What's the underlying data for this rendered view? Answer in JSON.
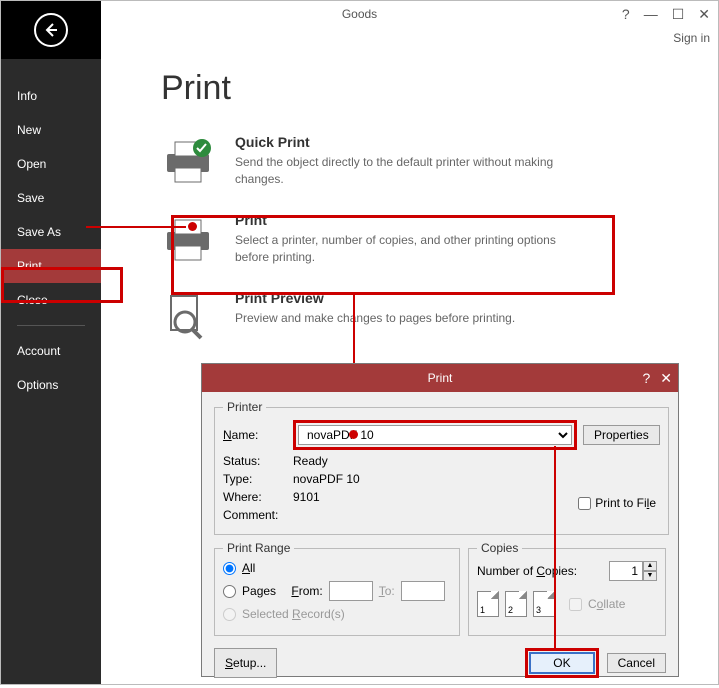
{
  "window": {
    "title": "Goods",
    "sign_in": "Sign in"
  },
  "sidebar": {
    "items": [
      "Info",
      "New",
      "Open",
      "Save",
      "Save As",
      "Print",
      "Close",
      "Account",
      "Options"
    ],
    "active_index": 5
  },
  "page": {
    "title": "Print",
    "options": [
      {
        "title": "Quick Print",
        "desc": "Send the object directly to the default printer without making changes."
      },
      {
        "title": "Print",
        "desc": "Select a printer, number of copies, and other printing options before printing."
      },
      {
        "title": "Print Preview",
        "desc": "Preview and make changes to pages before printing."
      }
    ]
  },
  "dialog": {
    "title": "Print",
    "printer_group": "Printer",
    "name_label": "Name:",
    "name_value": "novaPDF 10",
    "properties": "Properties",
    "status_label": "Status:",
    "status_value": "Ready",
    "type_label": "Type:",
    "type_value": "novaPDF 10",
    "where_label": "Where:",
    "where_value": "9101",
    "comment_label": "Comment:",
    "print_to_file": "Print to File",
    "range_group": "Print Range",
    "range_all": "All",
    "range_pages": "Pages",
    "from_label": "From:",
    "to_label": "To:",
    "range_selected": "Selected Record(s)",
    "copies_group": "Copies",
    "num_copies_label": "Number of Copies:",
    "num_copies_value": "1",
    "collate": "Collate",
    "collate_pages": [
      "1",
      "2",
      "3"
    ],
    "setup": "Setup...",
    "ok": "OK",
    "cancel": "Cancel"
  }
}
